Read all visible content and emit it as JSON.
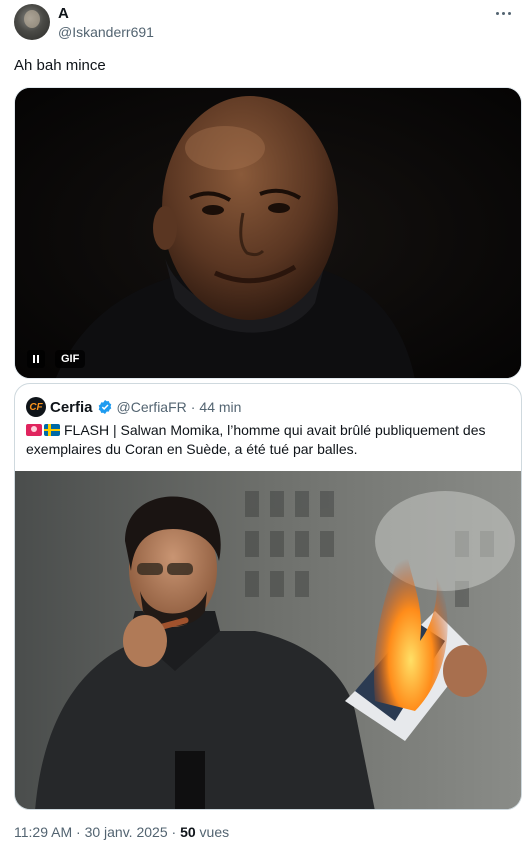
{
  "author": {
    "display_name": "A",
    "handle": "@Iskanderr691"
  },
  "tweet": {
    "text": "Ah bah mince"
  },
  "gif": {
    "badge": "GIF",
    "pause_icon": "pause-icon"
  },
  "quote": {
    "logo_text": "CF",
    "name": "Cerfia",
    "handle": "@CerfiaFR",
    "separator": "·",
    "time": "44 min",
    "text": "FLASH | Salwan Momika, l’homme qui avait brûlé publiquement des exemplaires du Coran en Suède, a été tué par balles.",
    "emoji": [
      "siren-icon",
      "sweden-flag-icon"
    ]
  },
  "footer": {
    "time": "11:29 AM",
    "separator": "·",
    "date": "30 janv. 2025",
    "views_count": "50",
    "views_label": "vues"
  },
  "colors": {
    "text": "#0f1419",
    "secondary": "#536471",
    "verified": "#1d9bf0",
    "border": "#cfd9de"
  }
}
